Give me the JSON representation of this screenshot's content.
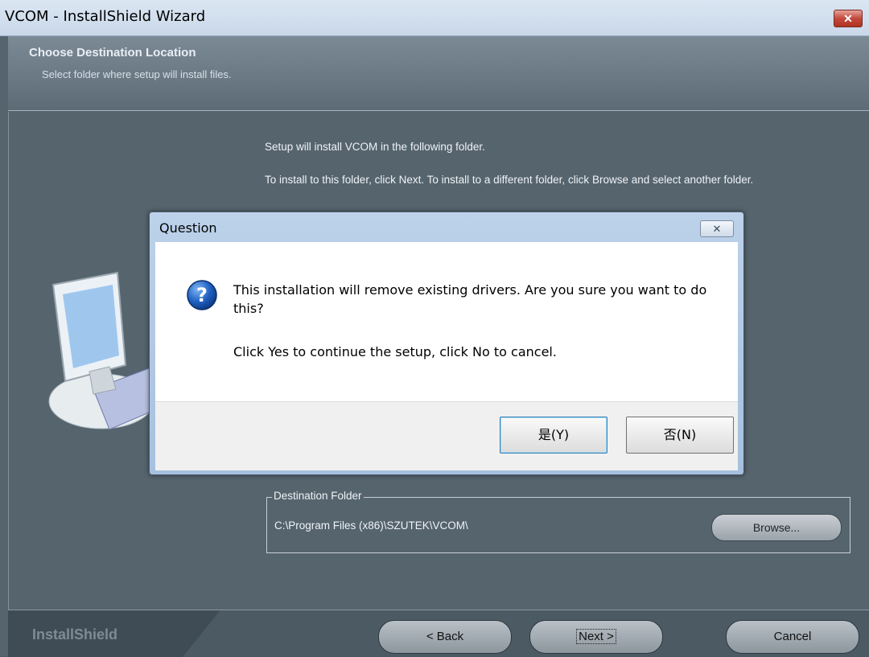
{
  "window": {
    "title": "VCOM - InstallShield Wizard",
    "close_glyph": "✕"
  },
  "header": {
    "title": "Choose Destination Location",
    "subtitle": "Select folder where setup will install files."
  },
  "body": {
    "line1": "Setup will install VCOM in the following folder.",
    "line2": "To install to this folder, click Next. To install to a different folder, click Browse and select another folder."
  },
  "destination": {
    "legend": "Destination Folder",
    "path": "C:\\Program Files (x86)\\SZUTEK\\VCOM\\",
    "browse_label": "Browse..."
  },
  "footer": {
    "brand": "InstallShield",
    "back_label": "< Back",
    "next_label": "Next >",
    "cancel_label": "Cancel"
  },
  "dialog": {
    "title": "Question",
    "close_glyph": "✕",
    "icon": "question-icon",
    "message": "This installation will remove existing drivers.  Are you sure you want to do this?",
    "message2": "Click Yes to continue the setup, click No to cancel.",
    "yes_label": "是(Y)",
    "no_label": "否(N)"
  }
}
